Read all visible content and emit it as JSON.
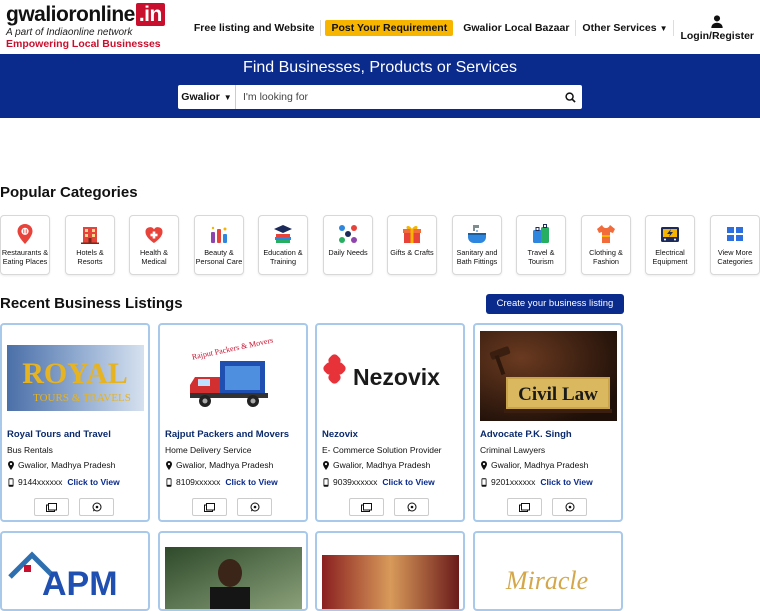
{
  "header": {
    "logo_main": "gwalioronline",
    "logo_tld": ".in",
    "logo_sub": "A part of Indiaonline network",
    "logo_tagline": "Empowering Local Businesses",
    "nav": {
      "free_listing": "Free listing and Website",
      "post_requirement": "Post Your Requirement",
      "local_bazaar": "Gwalior Local Bazaar",
      "other_services": "Other Services",
      "login": "Login/Register"
    }
  },
  "hero": {
    "title": "Find Businesses, Products or Services",
    "city": "Gwalior",
    "search_placeholder": "I'm looking for"
  },
  "popular": {
    "title": "Popular Categories",
    "categories": [
      {
        "label": "Restaurants & Eating Places",
        "icon": "restaurant-pin-icon"
      },
      {
        "label": "Hotels & Resorts",
        "icon": "hotel-icon"
      },
      {
        "label": "Health & Medical",
        "icon": "health-heart-icon"
      },
      {
        "label": "Beauty & Personal Care",
        "icon": "beauty-products-icon"
      },
      {
        "label": "Education & Training",
        "icon": "books-icon"
      },
      {
        "label": "Daily Needs",
        "icon": "daily-needs-icon"
      },
      {
        "label": "Gifts & Crafts",
        "icon": "gift-icon"
      },
      {
        "label": "Sanitary and Bath Fittings",
        "icon": "bath-fittings-icon"
      },
      {
        "label": "Travel & Tourism",
        "icon": "luggage-icon"
      },
      {
        "label": "Clothing & Fashion",
        "icon": "clothing-icon"
      },
      {
        "label": "Electrical Equipment",
        "icon": "electrical-icon"
      },
      {
        "label": "View More Categories",
        "icon": "grid-icon"
      }
    ]
  },
  "recent": {
    "title": "Recent Business Listings",
    "create_button": "Create your business listing",
    "click_to_view": "Click to View",
    "listings": [
      {
        "name": "Royal Tours and Travel",
        "category": "Bus Rentals",
        "location": "Gwalior, Madhya Pradesh",
        "phone": "9144xxxxxx",
        "image_text": "ROYAL",
        "image_sub": "TOURS & TRAVELS"
      },
      {
        "name": "Rajput Packers and Movers",
        "category": "Home Delivery Service",
        "location": "Gwalior, Madhya Pradesh",
        "phone": "8109xxxxxx",
        "image_text": "Rajput Packers & Movers"
      },
      {
        "name": "Nezovix",
        "category": "E- Commerce Solution Provider",
        "location": "Gwalior, Madhya Pradesh",
        "phone": "9039xxxxxx",
        "image_text": "Nezovix"
      },
      {
        "name": "Advocate P.K. Singh",
        "category": "Criminal Lawyers",
        "location": "Gwalior, Madhya Pradesh",
        "phone": "9201xxxxxx",
        "image_text": "Civil Law"
      }
    ],
    "more_listings": [
      {
        "image_text": "APM"
      },
      {
        "image_text": ""
      },
      {
        "image_text": ""
      },
      {
        "image_text": "Miracle"
      }
    ]
  },
  "colors": {
    "brand_blue": "#0a2a8c",
    "brand_red": "#c8102e",
    "accent_yellow": "#f7b500",
    "card_border": "#a9c9ea"
  }
}
